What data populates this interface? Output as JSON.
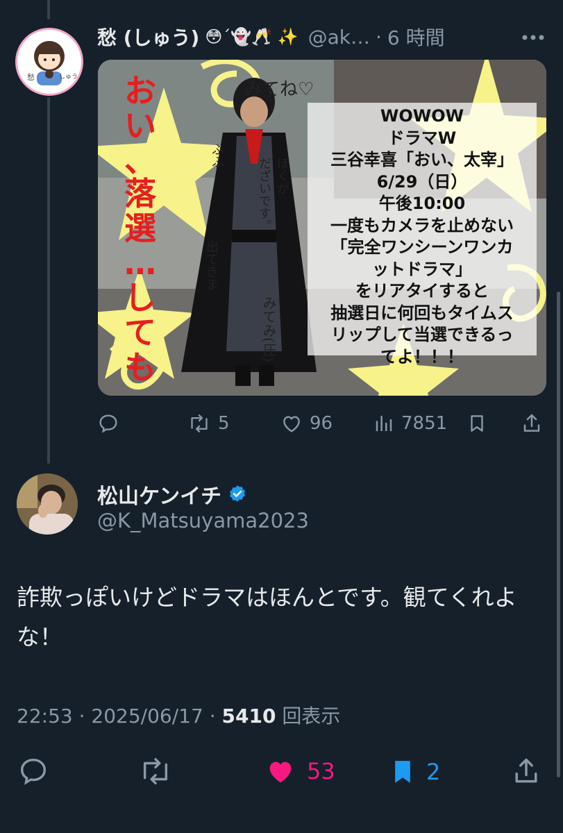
{
  "parent_tweet": {
    "display_name": "愁 (しゅう)",
    "emoji_suffix": "😳´👻🥂 ✨",
    "handle": "@ak…",
    "separator": "·",
    "time_ago": "6 時間",
    "more_label": "⋯",
    "avatar_caption_left": "愁",
    "avatar_caption_right": "しゅう",
    "image": {
      "red_column_1": [
        "お",
        "い",
        "、"
      ],
      "red_column_2": [
        "落",
        "選",
        "…",
        "し",
        "て",
        "も"
      ],
      "handwriting_top": "みてね♡",
      "handwriting_1": "ぼくが",
      "handwriting_2": "だざいです。",
      "handwriting_3": "ふふ",
      "handwriting_4": "出てきま",
      "handwriting_5": "みてみ(圧)",
      "promo_lines": [
        "WOWOW",
        "ドラマW",
        "三谷幸喜「おい、太宰」",
        "6/29（日）",
        "午後10:00",
        "一度もカメラを止めない",
        "「完全ワンシーンワンカ",
        "ットドラマ」",
        "をリアタイすると",
        "抽選日に何回もタイムス",
        "リップして当選できるっ",
        "てよ！！！"
      ]
    },
    "actions": {
      "reply_count": "",
      "retweet_count": "5",
      "like_count": "96",
      "view_count": "7851"
    }
  },
  "main_tweet": {
    "display_name": "松山ケンイチ",
    "verified": true,
    "handle": "@K_Matsuyama2023",
    "text": "詐欺っぽいけどドラマはほんとです。観てくれよな！",
    "time": "22:53",
    "date": "2025/06/17",
    "separator": "·",
    "views_count": "5410",
    "views_label": "回表示",
    "actions": {
      "like_count": "53",
      "bookmark_count": "2"
    }
  },
  "colors": {
    "background": "#15202b",
    "text": "#e7e9ea",
    "muted": "#8b98a5",
    "like": "#f91880",
    "bookmark": "#1d9bf0",
    "verified": "#1d9bf0",
    "promo_red": "#e51f1f",
    "star_yellow": "#f7f28a"
  },
  "icons": [
    "more-icon",
    "reply-icon",
    "retweet-icon",
    "like-icon",
    "views-icon",
    "bookmark-icon",
    "share-icon",
    "verified-badge-icon"
  ]
}
